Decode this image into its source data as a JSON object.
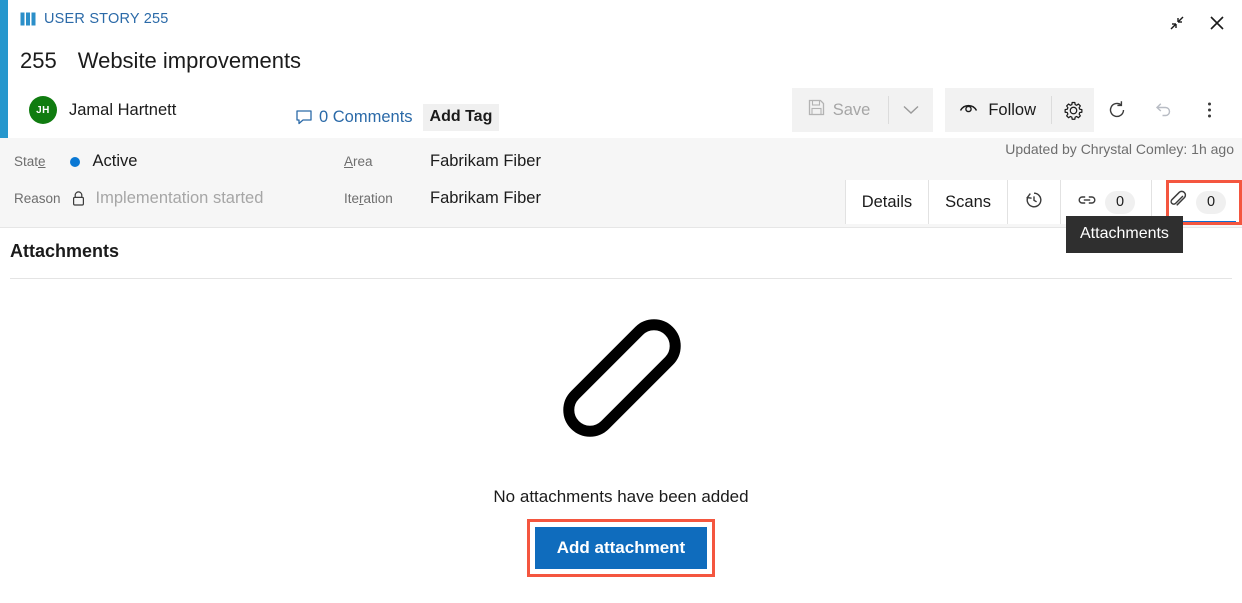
{
  "window": {
    "type_label": "USER STORY 255",
    "type_icon": "user-story-icon",
    "restore_icon": "collapse-arrows-icon",
    "close_icon": "close-icon"
  },
  "work_item": {
    "id": "255",
    "title": "Website improvements",
    "assignee": {
      "initials": "JH",
      "name": "Jamal Hartnett",
      "avatar_color": "#107c10"
    },
    "comments_label": "0 Comments",
    "add_tag_label": "Add Tag",
    "updated_by": "Updated by Chrystal Comley: 1h ago"
  },
  "toolbar": {
    "save_label": "Save",
    "save_chevron_icon": "chevron-down-icon",
    "follow_label": "Follow",
    "follow_icon": "eye-icon",
    "gear_icon": "gear-icon",
    "refresh_icon": "refresh-icon",
    "undo_icon": "undo-icon",
    "more_icon": "more-vertical-icon"
  },
  "fields": [
    {
      "label_pre": "Stat",
      "label_key": "e",
      "label_post": "",
      "value": "Active",
      "kind": "state",
      "muted": false
    },
    {
      "label_pre": "Reason",
      "label_key": "",
      "label_post": "",
      "value": "Implementation started",
      "kind": "locked",
      "muted": true
    },
    {
      "label_pre": "",
      "label_key": "A",
      "label_post": "rea",
      "value": "Fabrikam Fiber",
      "kind": "plain",
      "muted": false
    },
    {
      "label_pre": "Ite",
      "label_key": "r",
      "label_post": "ation",
      "value": "Fabrikam Fiber",
      "kind": "plain",
      "muted": false
    }
  ],
  "tabs": [
    {
      "label": "Details",
      "icon": null,
      "badge": null,
      "active": false
    },
    {
      "label": "Scans",
      "icon": null,
      "badge": null,
      "active": false
    },
    {
      "label": "",
      "icon": "history-icon",
      "badge": null,
      "active": false
    },
    {
      "label": "",
      "icon": "link-icon",
      "badge": "0",
      "active": false
    },
    {
      "label": "",
      "icon": "paperclip-icon",
      "badge": "0",
      "active": true
    }
  ],
  "tooltip": {
    "text": "Attachments"
  },
  "content": {
    "section_title": "Attachments",
    "empty_icon": "paperclip-large-icon",
    "empty_message": "No attachments have been added",
    "add_button_label": "Add attachment"
  },
  "colors": {
    "accent_bar": "#2697cd",
    "link": "#2b6aa8",
    "primary_button": "#0f6cbd",
    "highlight_box": "#f4563f",
    "active_tab_underline": "#0a6ed1",
    "state_dot": "#0a78d4",
    "tooltip_bg": "#2f2f2f"
  }
}
